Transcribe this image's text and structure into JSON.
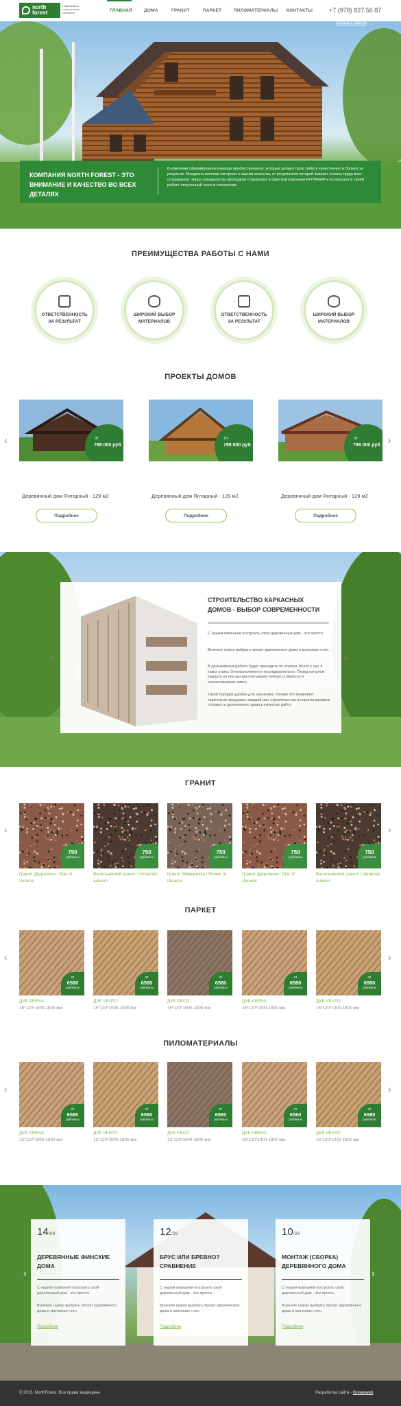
{
  "header": {
    "logo_line1": "north",
    "logo_line2": "forest",
    "logo_tagline": "Недвижимая строительная компания",
    "nav": [
      "ГЛАВНАЯ",
      "ДОМА",
      "ГРАНИТ",
      "ПАРКЕТ",
      "ПИЛОМАТЕРИАЛЫ",
      "КОНТАКТЫ"
    ],
    "phone": "+7 (978) 827 56 87",
    "order_call": "Заказать звонок"
  },
  "hero": {
    "title": "КОМПАНИЯ NORTH FOREST - ЭТО ВНИМАНИЕ И КАЧЕСТВО ВО ВСЕХ ДЕТАЛЯХ",
    "text": "В компании сформирована команда профессионалов, которые делают свою работу качественно и болеют за результат. Внедрена система контроля и оценки качества, от результатов которой зависит оплата труда всех сотрудников. Наши специалисты проходили стажировку в финской компании ROYANEM и использует в своей работе полученный опыт и технологии."
  },
  "advantages": {
    "title": "ПРЕИМУЩЕСТВА РАБОТЫ С НАМИ",
    "items": [
      {
        "label": "ОТВЕТСТВЕННОСТЬ ЗА РЕЗУЛЬТАТ",
        "icon": "document-icon"
      },
      {
        "label": "ШИРОКИЙ ВЫБОР МАТЕРИАЛОВ",
        "icon": "database-icon"
      },
      {
        "label": "ОТВЕТСТВЕННОСТЬ ЗА РЕЗУЛЬТАТ",
        "icon": "document-icon"
      },
      {
        "label": "ШИРОКИЙ ВЫБОР МАТЕРИАЛОВ",
        "icon": "database-icon"
      }
    ]
  },
  "projects": {
    "title": "ПРОЕКТЫ ДОМОВ",
    "items": [
      {
        "from": "от",
        "price": "798 000 руб",
        "caption": "Деревянный дом Янтарный - 129 м2",
        "button": "Подробнее"
      },
      {
        "from": "от",
        "price": "798 000 руб",
        "caption": "Деревянный дом Янтарный - 129 м2",
        "button": "Подробнее"
      },
      {
        "from": "от",
        "price": "798 000 руб",
        "caption": "Деревянный дом Янтарный - 129 м2",
        "button": "Подробнее"
      }
    ]
  },
  "frame": {
    "title": "СТРОИТЕЛЬСТВО КАРКАСНЫХ ДОМОВ - ВЫБОР СОВРЕМЕННОСТИ",
    "p1": "С нашей компаней построить свой деревянный дом - это просто.",
    "p2": "Вначале нужно выбрать проект деревянного дома и материал стен.",
    "p3": "В дальнейшем работа будет проходить по этапам. Всего у нас 4 таких этапа. Они выполняются последовательно. Перед началом каждого из них мы рассчитываем точную стоимость и согласовываем смету.",
    "p4": "Такой порядок удобен для заказчика, потому что позволяет тщательно продумать каждый шаг строительства и спрогнозировать стоимость деревянного дома и качество работ."
  },
  "granite": {
    "title": "ГРАНИТ",
    "items": [
      {
        "price": "750",
        "unit": "рубл/кв.м",
        "caption": "Гранит Дидковичи / Star of Ukraine",
        "color": "#8a5a48"
      },
      {
        "price": "750",
        "unit": "рубл/кв.м",
        "caption": "Васильевский гранит / Ukrainian autumn",
        "color": "#4a3a30"
      },
      {
        "price": "750",
        "unit": "рубл/кв.м",
        "caption": "Гранит Межиричка / Flower of Ukraine",
        "color": "#7a6458"
      },
      {
        "price": "750",
        "unit": "рубл/кв.м",
        "caption": "Гранит Дидковичи / Star of Ukraine",
        "color": "#8a5a48"
      },
      {
        "price": "750",
        "unit": "рубл/кв.м",
        "caption": "Васильевский гранит / Ukrainian autumn",
        "color": "#4a3a30"
      }
    ]
  },
  "parquet": {
    "title": "ПАРКЕТ",
    "items": [
      {
        "from": "от",
        "price": "6580",
        "unit": "рубл/кв.м",
        "name": "ДУБ ARENA",
        "size": "15*120*1000-1800 мм",
        "color": "#c9a27a"
      },
      {
        "from": "от",
        "price": "6580",
        "unit": "рубл/кв.м",
        "name": "ДУБ VENTO",
        "size": "15*120*1000-1800 мм",
        "color": "#c8a273"
      },
      {
        "from": "от",
        "price": "6580",
        "unit": "рубл/кв.м",
        "name": "ДУБ DECO",
        "size": "15*120*1000-1800 мм",
        "color": "#8a7464"
      },
      {
        "from": "от",
        "price": "6580",
        "unit": "рубл/кв.м",
        "name": "ДУБ ARENA",
        "size": "15*120*1000-1800 мм",
        "color": "#c9a27a"
      },
      {
        "from": "от",
        "price": "6580",
        "unit": "рубл/кв.м",
        "name": "ДУБ VENTO",
        "size": "15*120*1000-1800 мм",
        "color": "#c8a273"
      }
    ]
  },
  "lumber": {
    "title": "ПИЛОМАТЕРИАЛЫ",
    "items": [
      {
        "from": "от",
        "price": "6580",
        "unit": "рубл/кв.м",
        "name": "ДУБ ARENA",
        "size": "15*120*1000-1800 мм",
        "color": "#c9a27a"
      },
      {
        "from": "от",
        "price": "6580",
        "unit": "рубл/кв.м",
        "name": "ДУБ VENTO",
        "size": "15*120*1000-1800 мм",
        "color": "#c8a273"
      },
      {
        "from": "от",
        "price": "6580",
        "unit": "рубл/кв.м",
        "name": "ДУБ DECO",
        "size": "15*120*1000-1800 мм",
        "color": "#8a7464"
      },
      {
        "from": "от",
        "price": "6580",
        "unit": "рубл/кв.м",
        "name": "ДУБ ARENA",
        "size": "15*120*1000-1800 мм",
        "color": "#c9a27a"
      },
      {
        "from": "от",
        "price": "6580",
        "unit": "рубл/кв.м",
        "name": "ДУБ VENTO",
        "size": "15*120*1000-1800 мм",
        "color": "#c8a273"
      }
    ]
  },
  "news": [
    {
      "day": "14",
      "month": "/09",
      "title": "ДЕРЕВЯННЫЕ ФИНСКИЕ ДОМА",
      "p1": "С нашей компаней построить свой деревянный дом - это просто.",
      "p2": "Вначале нужно выбрать проект деревянного дома и материал стен.",
      "more": "Подробнее"
    },
    {
      "day": "12",
      "month": "/09",
      "title": "БРУС ИЛИ БРЕВНО? СРАВНЕНИЕ",
      "p1": "С нашей компаней построить свой деревянный дом - это просто.",
      "p2": "Вначале нужно выбрать проект деревянного дома и материал стен.",
      "more": "Подробнее"
    },
    {
      "day": "10",
      "month": "/09",
      "title": "МОНТАЖ (СБОРКА) ДЕРЕВЯННОГО ДОМА",
      "p1": "С нашей компаней построить свой деревянный дом - это просто.",
      "p2": "Вначале нужно выбрать проект деревянного дома и материал стен.",
      "more": "Подробнее"
    }
  ],
  "footer": {
    "copyright": "© 2015, NorthForest. Все права защищены",
    "dev_label": "Разработка сайта -",
    "dev_link": "Growwweb"
  },
  "colors": {
    "brand_green": "#2f7d32",
    "accent_light_green": "#7cb342",
    "footer": "#333333"
  }
}
